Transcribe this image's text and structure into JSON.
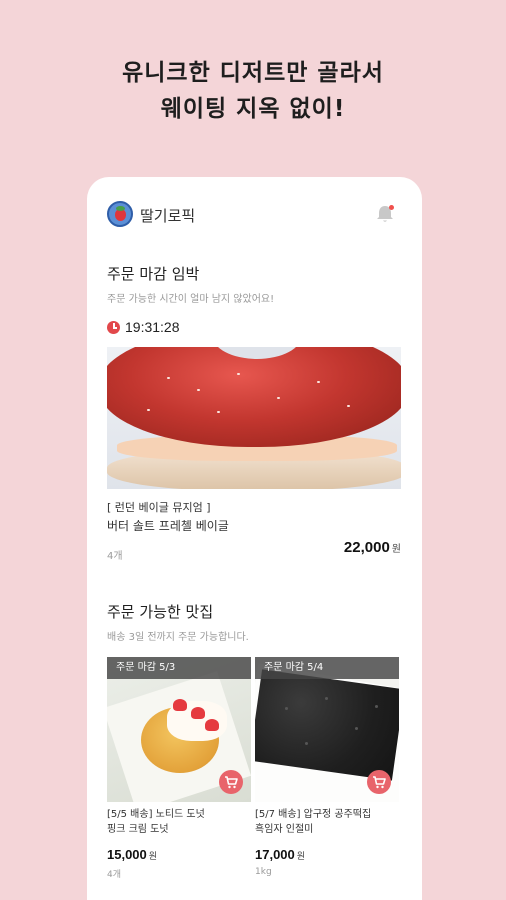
{
  "headline": {
    "line1": "유니크한 디저트만 골라서",
    "line2": "웨이팅 지옥 없이!"
  },
  "app": {
    "title": "딸기로픽",
    "logo_icon": "strawberry-logo-icon",
    "notification_icon": "bell-icon"
  },
  "closing_soon": {
    "title": "주문 마감 임박",
    "subtitle": "주문 가능한 시간이 얼마 남지 않았어요!",
    "timer": "19:31:28",
    "product": {
      "shop": "[ 런던 베이글 뮤지엄 ]",
      "name": "버터 솔트 프레첼 베이글",
      "qty": "4개",
      "price": "22,000",
      "currency": "원"
    }
  },
  "available": {
    "title": "주문 가능한 맛집",
    "subtitle": "배송 3일 전까지 주문 가능합니다.",
    "items": [
      {
        "deadline": "주문 마감 5/3",
        "title_line1": "[5/5 배송] 노티드 도넛",
        "title_line2": "핑크 크림 도넛",
        "price": "15,000",
        "currency": "원",
        "qty": "4개"
      },
      {
        "deadline": "주문 마감 5/4",
        "title_line1": "[5/7 배송] 압구정 공주떡집",
        "title_line2": "흑임자 인절미",
        "price": "17,000",
        "currency": "원",
        "qty": "1kg"
      }
    ]
  },
  "colors": {
    "background": "#f4d5d8",
    "accent": "#e8646b",
    "timer_icon": "#e2484b"
  }
}
